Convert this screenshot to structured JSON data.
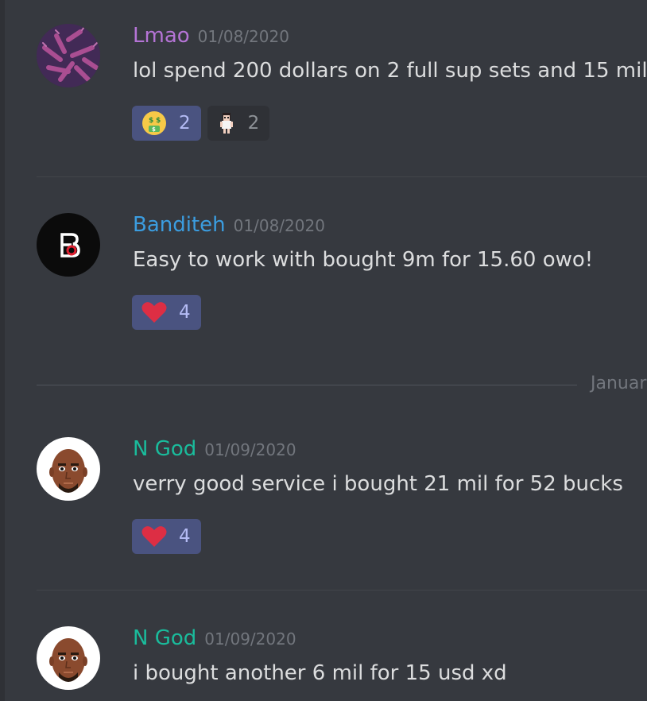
{
  "messages": [
    {
      "username": "Lmao",
      "username_color": "#b574d6",
      "timestamp": "01/08/2020",
      "content": "lol spend 200 dollars on 2 full sup sets and 15 mil",
      "avatar_icon": "virus-cluster-avatar",
      "reactions": [
        {
          "emoji": "money-mouth-face-icon",
          "count": "2",
          "me": true
        },
        {
          "emoji": "pixel-character-icon",
          "count": "2",
          "me": false
        }
      ]
    },
    {
      "username": "Banditeh",
      "username_color": "#3b9de0",
      "timestamp": "01/08/2020",
      "content": "Easy to work with bought 9m for 15.60 owo!",
      "avatar_icon": "b-logo-avatar",
      "reactions": [
        {
          "emoji": "red-heart-icon",
          "count": "4",
          "me": true
        }
      ]
    },
    {
      "username": "N God",
      "username_color": "#1abc9c",
      "timestamp": "01/09/2020",
      "content": "verry good service i bought 21 mil for 52 bucks",
      "avatar_icon": "mii-face-avatar",
      "reactions": [
        {
          "emoji": "red-heart-icon",
          "count": "4",
          "me": true
        }
      ]
    },
    {
      "username": "N God",
      "username_color": "#1abc9c",
      "timestamp": "01/09/2020",
      "content": "i bought another 6 mil for 15 usd xd",
      "avatar_icon": "mii-face-avatar",
      "reactions": []
    }
  ],
  "date_divider": {
    "label": "Januar"
  }
}
